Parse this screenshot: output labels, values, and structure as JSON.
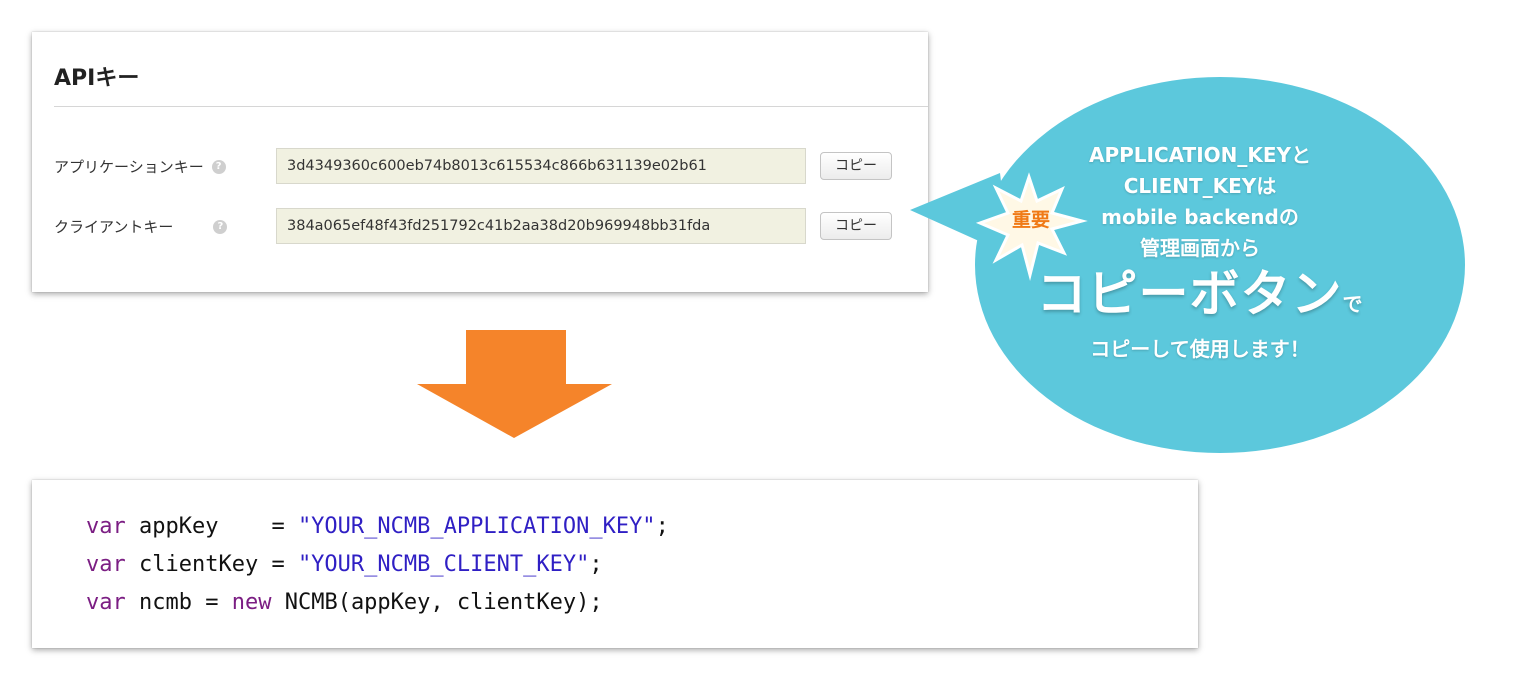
{
  "api_panel": {
    "title": "APIキー",
    "help_glyph": "?",
    "rows": [
      {
        "label": "アプリケーションキー",
        "value": "3d4349360c600eb74b8013c615534c866b631139e02b61",
        "copy_label": "コピー"
      },
      {
        "label": "クライアントキー",
        "value": "384a065ef48f43fd251792c41b2aa38d20b969948bb31fda",
        "copy_label": "コピー"
      }
    ]
  },
  "arrow": {
    "color": "#f5842a",
    "icon": "down-arrow-icon"
  },
  "code": {
    "lines": [
      {
        "keyword": "var",
        "text": " appKey    = ",
        "string": "\"YOUR_NCMB_APPLICATION_KEY\"",
        "tail": ";"
      },
      {
        "keyword": "var",
        "text": " clientKey = ",
        "string": "\"YOUR_NCMB_CLIENT_KEY\"",
        "tail": ";"
      },
      {
        "keyword": "var",
        "text": " ncmb = ",
        "keyword2": "new",
        "text2": " NCMB(appKey, clientKey);"
      }
    ]
  },
  "callout": {
    "bubble_color": "#5cc8dc",
    "badge": {
      "label": "重要",
      "color": "#f07a16",
      "icon": "starburst-icon"
    },
    "lines": [
      "APPLICATION_KEYと",
      "CLIENT_KEYは",
      "mobile backendの",
      "管理画面から"
    ],
    "big_text": "コピーボタン",
    "big_suffix": "で",
    "last_line": "コピーして使用します！"
  }
}
